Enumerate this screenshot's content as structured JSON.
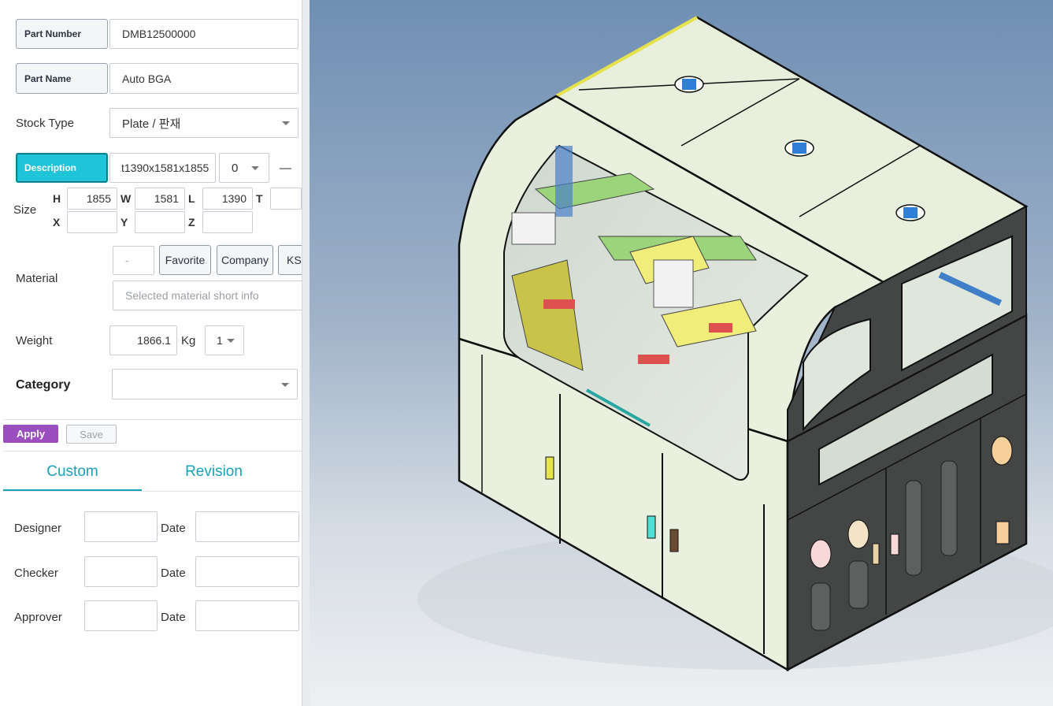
{
  "form": {
    "part_number_label": "Part Number",
    "part_number_value": "DMB12500000",
    "part_name_label": "Part Name",
    "part_name_value": "Auto BGA",
    "stock_type_label": "Stock Type",
    "stock_type_value": "Plate / 판재",
    "description_label": "Description",
    "description_value": "t1390x1581x1855",
    "description_count": "0",
    "description_dash": "—",
    "size_label": "Size",
    "h_label": "H",
    "h_value": "1855",
    "w_label": "W",
    "w_value": "1581",
    "l_label": "L",
    "l_value": "1390",
    "t_label": "T",
    "t_value": "",
    "x_label": "X",
    "x_value": "",
    "y_label": "Y",
    "y_value": "",
    "z_label": "Z",
    "z_value": "",
    "material_label": "Material",
    "material_value": "-",
    "material_favorite": "Favorite",
    "material_company": "Company",
    "material_ks": "KS",
    "material_placeholder": "Selected material short info",
    "weight_label": "Weight",
    "weight_value": "1866.1",
    "weight_unit": "Kg",
    "weight_qty": "1",
    "category_label": "Category",
    "category_value": ""
  },
  "actions": {
    "apply": "Apply",
    "save": "Save"
  },
  "tabs": [
    {
      "label": "Custom",
      "active": true
    },
    {
      "label": "Revision",
      "active": false
    }
  ],
  "signoff": {
    "designer_label": "Designer",
    "checker_label": "Checker",
    "approver_label": "Approver",
    "date_label": "Date"
  },
  "colors": {
    "accent_teal": "#1fc4d9",
    "tab_teal": "#17a2b8",
    "apply_purple": "#9b4fbf",
    "machine_body": "#e9f0de",
    "machine_dark": "#434645"
  }
}
